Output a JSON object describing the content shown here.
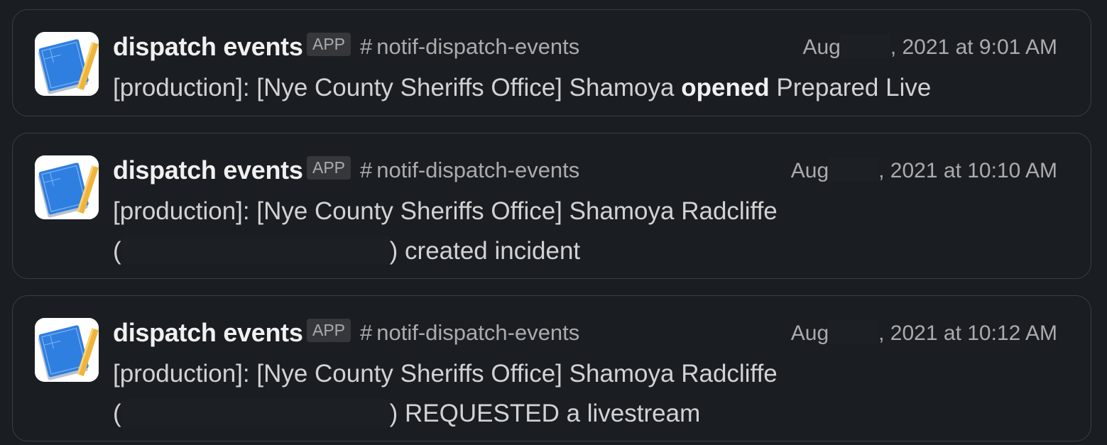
{
  "messages": [
    {
      "sender": "dispatch events",
      "badge": "APP",
      "channel": "notif-dispatch-events",
      "ts_prefix": "Aug",
      "ts_suffix": ", 2021 at 9:01 AM",
      "line1": "[production]: [Nye County Sheriffs Office] Shamoya ",
      "line1_bold": "opened",
      "line1_tail": " Prepared Live",
      "avatar_icon": "blueprint-pencil-icon"
    },
    {
      "sender": "dispatch events",
      "badge": "APP",
      "channel": "notif-dispatch-events",
      "ts_prefix": "Aug",
      "ts_suffix": ", 2021 at 10:10 AM",
      "line1": "[production]: [Nye County Sheriffs Office] Shamoya Radcliffe",
      "line2_open": "(",
      "line2_tail": ") created incident",
      "avatar_icon": "blueprint-pencil-icon"
    },
    {
      "sender": "dispatch events",
      "badge": "APP",
      "channel": "notif-dispatch-events",
      "ts_prefix": "Aug",
      "ts_suffix": ", 2021 at 10:12 AM",
      "line1": "[production]: [Nye County Sheriffs Office] Shamoya Radcliffe",
      "line2_open": "(",
      "line2_tail": ") REQUESTED a livestream",
      "avatar_icon": "blueprint-pencil-icon"
    }
  ],
  "channel_symbol": "#",
  "colors": {
    "background": "#1a1d21",
    "card_border": "#3a3d42",
    "sender_text": "#f0f0f0",
    "meta_text": "#ababad",
    "body_text": "#d1d2d3",
    "avatar_blue": "#2f7fe0",
    "avatar_pencil": "#f0b43a"
  }
}
